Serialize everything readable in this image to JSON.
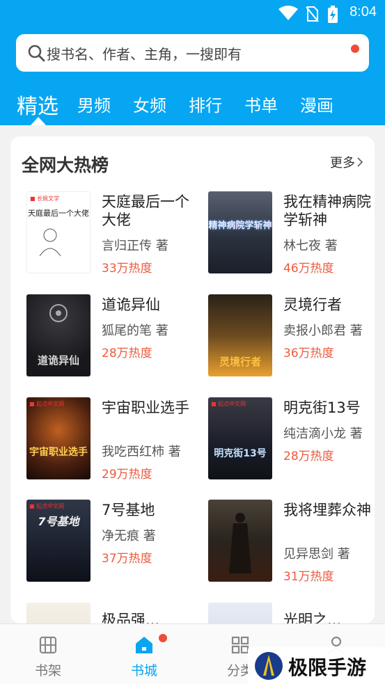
{
  "status_bar": {
    "time": "8:04"
  },
  "search": {
    "placeholder": "搜书名、作者、主角，一搜即有"
  },
  "tabs": [
    {
      "label": "精选",
      "active": true
    },
    {
      "label": "男频"
    },
    {
      "label": "女频"
    },
    {
      "label": "排行"
    },
    {
      "label": "书单"
    },
    {
      "label": "漫画"
    }
  ],
  "hot_list": {
    "title": "全网大热榜",
    "more_label": "更多",
    "books": [
      {
        "title": "天庭最后一个大佬",
        "author": "言归正传 著",
        "heat": "33万热度",
        "cover_text": "天庭最后一个大佬"
      },
      {
        "title": "我在精神病院学斩神",
        "author": "林七夜 著",
        "heat": "46万热度",
        "cover_text": "精神病院学斩神"
      },
      {
        "title": "道诡异仙",
        "author": "狐尾的笔 著",
        "heat": "28万热度",
        "cover_text": "道诡异仙"
      },
      {
        "title": "灵境行者",
        "author": "卖报小郎君 著",
        "heat": "36万热度",
        "cover_text": "灵境行者"
      },
      {
        "title": "宇宙职业选手",
        "author": "我吃西红柿 著",
        "heat": "29万热度",
        "cover_text": "宇宙职业选手"
      },
      {
        "title": "明克街13号",
        "author": "纯洁滴小龙 著",
        "heat": "28万热度",
        "cover_text": "明克街13号"
      },
      {
        "title": "7号基地",
        "author": "净无痕 著",
        "heat": "37万热度",
        "cover_text": "7号基地"
      },
      {
        "title": "我将埋葬众神",
        "author": "见异思剑 著",
        "heat": "31万热度",
        "cover_text": ""
      }
    ],
    "partial_row": [
      "极品强...",
      "光明之..."
    ]
  },
  "bottom_nav": [
    {
      "label": "书架"
    },
    {
      "label": "书城",
      "active": true,
      "badge": true
    },
    {
      "label": "分类"
    },
    {
      "label": "我的"
    }
  ],
  "watermark": {
    "text": "极限手游网"
  },
  "colors": {
    "accent": "#06a6f2",
    "heat": "#ee5a3d",
    "badge": "#f04a3a"
  }
}
